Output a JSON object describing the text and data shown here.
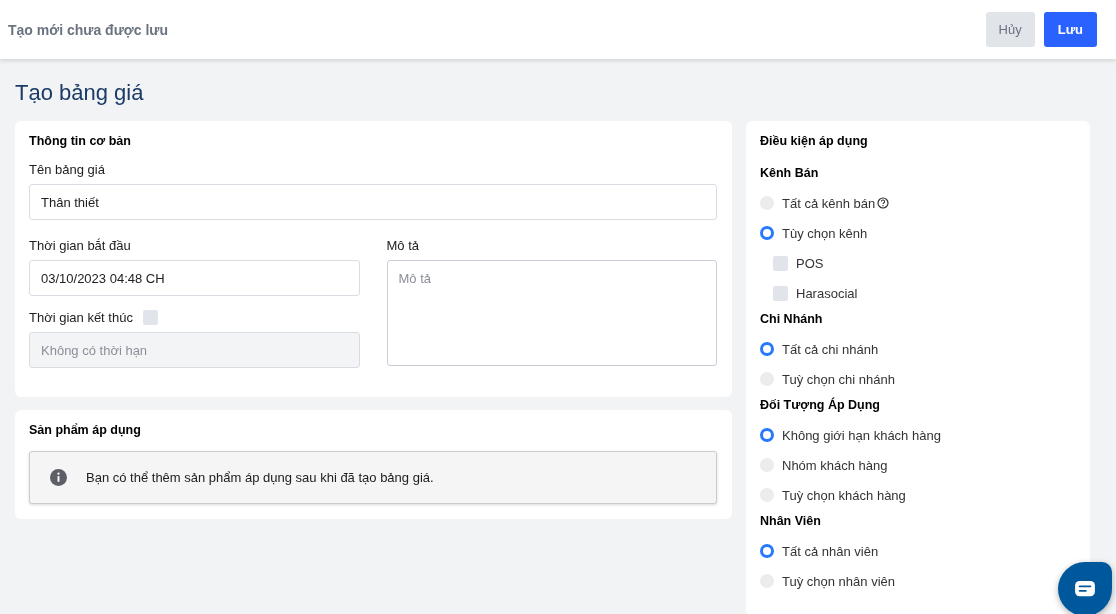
{
  "header": {
    "title": "Tạo mới chưa được lưu",
    "buttons": [
      {
        "label": "Hủy",
        "kind": "secondary"
      },
      {
        "label": "Lưu",
        "kind": "primary"
      }
    ]
  },
  "page_title": "Tạo bảng giá",
  "basic_info": {
    "title": "Thông tin cơ bản",
    "name_label": "Tên bảng giá",
    "name_value": "Thân thiết",
    "start_label": "Thời gian bắt đầu",
    "start_value": "03/10/2023 04:48 CH",
    "end_label": "Thời gian kết thúc",
    "end_checked": false,
    "end_placeholder": "Không có thời hạn",
    "end_disabled": true,
    "desc_label": "Mô tả",
    "desc_placeholder": "Mô tả"
  },
  "products": {
    "title": "Sản phẩm áp dụng",
    "notice": "Bạn có thể thêm sản phẩm áp dụng sau khi đã tạo bảng giá."
  },
  "conditions": {
    "title": "Điều kiện áp dụng",
    "groups": [
      {
        "title": "Kênh Bán",
        "options": [
          {
            "kind": "radio",
            "label": "Tất cả kênh bán",
            "selected": false,
            "help": true
          },
          {
            "kind": "radio",
            "label": "Tùy chọn kênh",
            "selected": true
          },
          {
            "kind": "checkbox",
            "label": "POS",
            "checked": false
          },
          {
            "kind": "checkbox",
            "label": "Harasocial",
            "checked": false
          }
        ]
      },
      {
        "title": "Chi Nhánh",
        "options": [
          {
            "kind": "radio",
            "label": "Tất cả chi nhánh",
            "selected": true
          },
          {
            "kind": "radio",
            "label": "Tuỳ chọn chi nhánh",
            "selected": false
          }
        ]
      },
      {
        "title": "Đối Tượng Áp Dụng",
        "options": [
          {
            "kind": "radio",
            "label": "Không giới hạn khách hàng",
            "selected": true
          },
          {
            "kind": "radio",
            "label": "Nhóm khách hàng",
            "selected": false
          },
          {
            "kind": "radio",
            "label": "Tuỳ chọn khách hàng",
            "selected": false
          }
        ]
      },
      {
        "title": "Nhân Viên",
        "options": [
          {
            "kind": "radio",
            "label": "Tất cả nhân viên",
            "selected": true
          },
          {
            "kind": "radio",
            "label": "Tuỳ chọn nhân viên",
            "selected": false
          }
        ]
      }
    ]
  }
}
